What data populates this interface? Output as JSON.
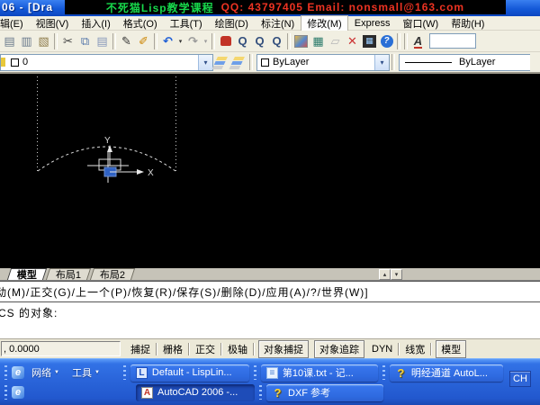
{
  "titlebar": {
    "title": "06 - [Dra",
    "banner_course": "不死猫Lisp教学课程",
    "banner_contact": "QQ: 43797405  Email: nonsmall@163.com",
    "banner_course_color": "#17d84b",
    "banner_contact_color": "#ee3322"
  },
  "menu": {
    "items": [
      "辑(E)",
      "视图(V)",
      "插入(I)",
      "格式(O)",
      "工具(T)",
      "绘图(D)",
      "标注(N)",
      "修改(M)",
      "Express",
      "窗口(W)",
      "帮助(H)"
    ],
    "highlighted": "修改(M)"
  },
  "toolbar": {
    "icons": [
      {
        "name": "plot-icon",
        "glyph": "▤",
        "style": "color:#6b7b8d"
      },
      {
        "name": "plot-preview-icon",
        "glyph": "▥",
        "style": "color:#6b7b8d"
      },
      {
        "name": "publish-icon",
        "glyph": "▧",
        "style": "color:#8d7b4a"
      },
      {
        "name": "cut-icon",
        "glyph": "✂",
        "style": "color:#444444"
      },
      {
        "name": "copy-icon",
        "glyph": "⧉",
        "style": "color:#5577aa"
      },
      {
        "name": "paste-icon",
        "glyph": "▤",
        "style": "color:#8899bb"
      },
      {
        "name": "match-properties-icon",
        "glyph": "✎",
        "style": "color:#333333"
      },
      {
        "name": "block-editor-icon",
        "glyph": "✐",
        "style": "color:#cc8400"
      },
      {
        "name": "undo-icon",
        "glyph": "↶",
        "style": "color:#1f5fd6;font-weight:bold"
      },
      {
        "name": "undo-caret-icon",
        "glyph": "▾",
        "style": "color:#333333"
      },
      {
        "name": "redo-icon",
        "glyph": "↷",
        "style": "color:#9a9a9a;font-weight:bold"
      },
      {
        "name": "redo-caret-icon",
        "glyph": "▾",
        "style": "color:#9a9a9a"
      },
      {
        "name": "zoom-realtime-icon",
        "glyph": "Q",
        "style": "color:#334f7d;font-weight:bold"
      },
      {
        "name": "zoom-window-icon",
        "glyph": "Q",
        "style": "color:#334f7d;font-weight:bold"
      },
      {
        "name": "zoom-previous-icon",
        "glyph": "Q",
        "style": "color:#334f7d;font-weight:bold"
      },
      {
        "name": "designcenter-icon",
        "glyph": "▦",
        "style": "color:#2a7a6a"
      },
      {
        "name": "sheetset-icon",
        "glyph": "▱",
        "style": "color:#b8b8b8"
      },
      {
        "name": "markup-icon",
        "glyph": "✕",
        "style": "color:#cc3333;font-weight:bold"
      },
      {
        "name": "quickcalc-grid-glyph",
        "glyph": "▦",
        "style": ""
      },
      {
        "name": "help-question-glyph",
        "glyph": "?",
        "style": ""
      },
      {
        "name": "text-style-glyph",
        "glyph": "A",
        "style": ""
      }
    ]
  },
  "properties_bar": {
    "layer_value": "0",
    "color_value": "ByLayer",
    "linetype_value": "ByLayer"
  },
  "canvas": {
    "axis_x_label": "X",
    "axis_y_label": "Y"
  },
  "tabs": {
    "items": [
      "模型",
      "布局1",
      "布局2"
    ],
    "active": "模型"
  },
  "command": {
    "line1": "动(M)/正交(G)/上一个(P)/恢复(R)/保存(S)/删除(D)/应用(A)/?/世界(W)]",
    "line2": "CS 的对象:"
  },
  "statusbar": {
    "coords": ", 0.0000",
    "toggles": [
      {
        "label": "捕捉",
        "active": false
      },
      {
        "label": "栅格",
        "active": false
      },
      {
        "label": "正交",
        "active": false
      },
      {
        "label": "极轴",
        "active": false
      },
      {
        "label": "对象捕捉",
        "active": true
      },
      {
        "label": "对象追踪",
        "active": true
      },
      {
        "label": "DYN",
        "active": false
      },
      {
        "label": "线宽",
        "active": false
      },
      {
        "label": "模型",
        "active": true
      }
    ]
  },
  "taskbar": {
    "quicklaunch": [
      "网络",
      "工具"
    ],
    "icons": {
      "ie": "e",
      "lisp": "L",
      "notepad": "≡",
      "help": "?",
      "acad": "A"
    },
    "tasks_row1": [
      {
        "label": "Default - LispLin...",
        "active": false
      },
      {
        "label": "第10课.txt - 记...",
        "active": false
      },
      {
        "label": "明经通道 AutoL...",
        "active": false
      }
    ],
    "tasks_row2": [
      {
        "label": "AutoCAD 2006 -...",
        "active": true
      },
      {
        "label": "DXF 参考",
        "active": false
      }
    ],
    "language": "CH"
  },
  "glyphs": {
    "dropdown": "▾",
    "scroll_up": "▴",
    "scroll_down": "▾",
    "quicklaunch_arrow": "▼"
  }
}
